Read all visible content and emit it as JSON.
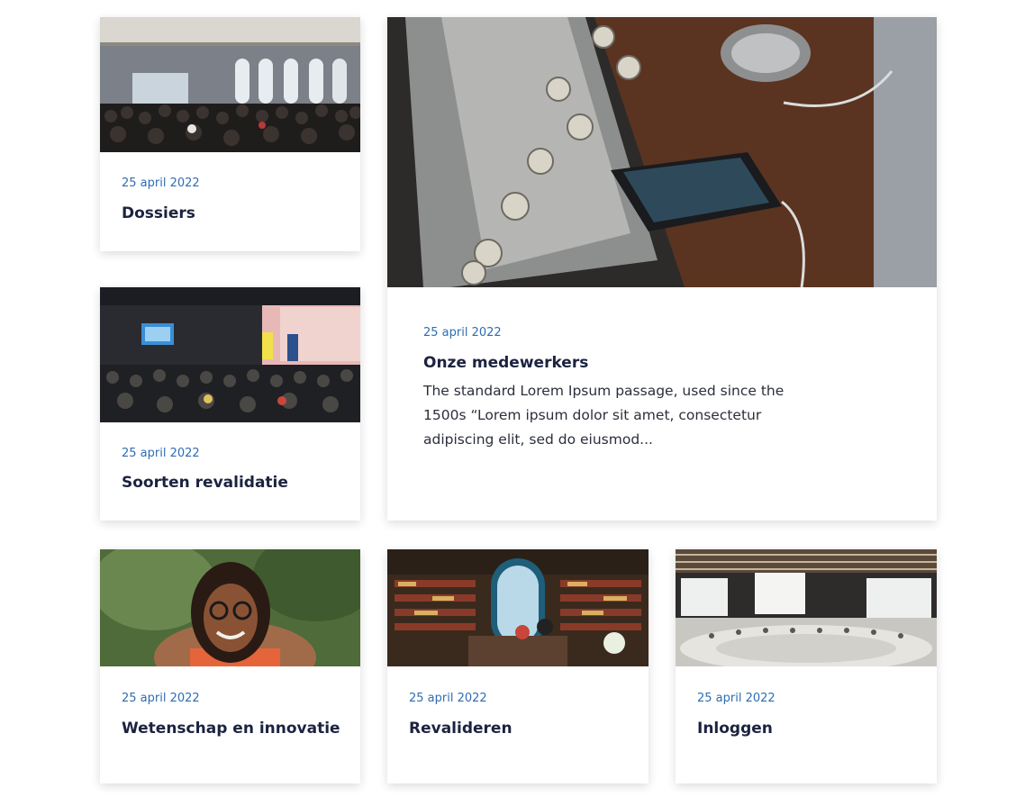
{
  "cards": [
    {
      "date": "25 april 2022",
      "title": "Dossiers",
      "image": "conference-hall-photo"
    },
    {
      "date": "25 april 2022",
      "title": "Onze medewerkers",
      "excerpt": "The standard Lorem Ipsum passage, used since the 1500s “Lorem ipsum dolor sit amet, consectetur adipiscing elit, sed do eiusmod...",
      "image": "radio-and-phone-photo"
    },
    {
      "date": "25 april 2022",
      "title": "Soorten revalidatie",
      "image": "event-stage-photo"
    },
    {
      "date": "25 april 2022",
      "title": "Wetenschap en innovatie",
      "image": "smiling-woman-photo"
    },
    {
      "date": "25 april 2022",
      "title": "Revalideren",
      "image": "bookstore-photo"
    },
    {
      "date": "25 april 2022",
      "title": "Inloggen",
      "image": "auditorium-photo"
    }
  ],
  "colors": {
    "date": "#2e6db4",
    "title": "#1b2340",
    "text": "#2b2f3a"
  }
}
